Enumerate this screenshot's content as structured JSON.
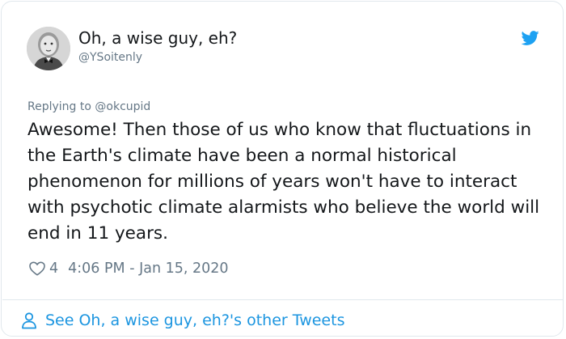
{
  "author": {
    "name": "Oh, a wise guy, eh?",
    "handle": "@YSoitenly"
  },
  "reply": {
    "prefix": "Replying to ",
    "to": "@okcupid"
  },
  "tweet": {
    "text": "Awesome! Then those of us who know that fluctuations in the Earth's climate have been a normal historical phenomenon for millions of years won't have to interact with psychotic climate alarmists who believe the world will end in 11 years."
  },
  "meta": {
    "like_count": "4",
    "timestamp": "4:06 PM - Jan 15, 2020"
  },
  "footer": {
    "link_label": "See Oh, a wise guy, eh?'s other Tweets"
  },
  "icons": {
    "bird": "twitter-bird-icon",
    "like": "heart-icon",
    "profile": "person-icon"
  },
  "colors": {
    "brand": "#1da1f2",
    "link": "#1b95e0",
    "secondary_text": "#657786",
    "border": "#e1e8ed"
  }
}
